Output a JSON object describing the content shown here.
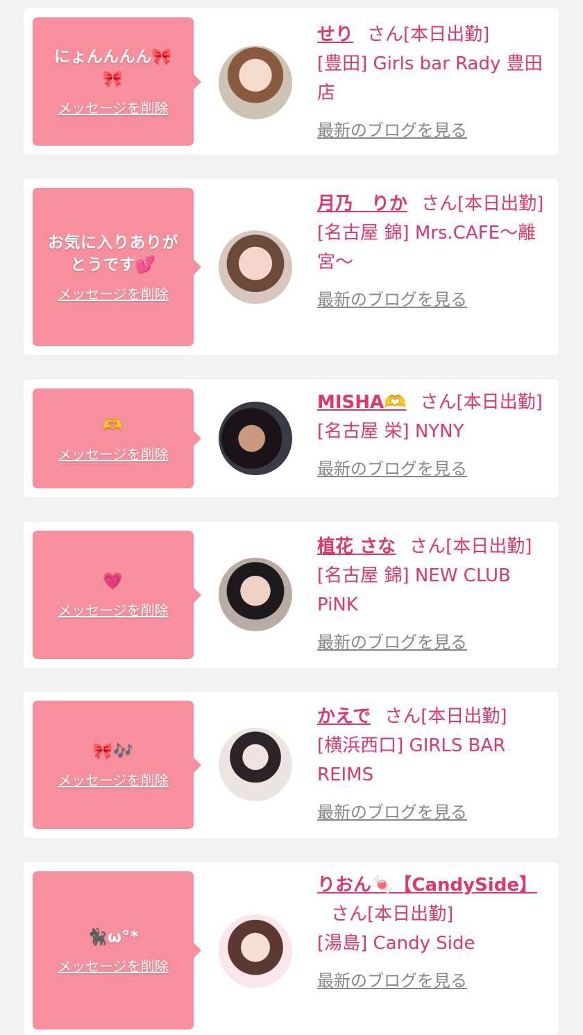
{
  "cards": [
    {
      "message": "にょんんんん🎀🎀",
      "delete_label": "メッセージを削除",
      "name": "せり",
      "san_label": "さん[本日出勤]",
      "shop": "[豊田] Girls bar Rady 豊田店",
      "blog_label": "最新のブログを見る"
    },
    {
      "message": "お気に入りありがとうです💕",
      "delete_label": "メッセージを削除",
      "name": "月乃　りか",
      "san_label": "さん[本日出勤]",
      "shop": "[名古屋 錦] Mrs.CAFE〜離宮〜",
      "blog_label": "最新のブログを見る"
    },
    {
      "message": "🫶",
      "delete_label": "メッセージを削除",
      "name": "MISHA🫶",
      "san_label": "さん[本日出勤]",
      "shop": "[名古屋 栄] NYNY",
      "blog_label": "最新のブログを見る"
    },
    {
      "message": "💗",
      "delete_label": "メッセージを削除",
      "name": "植花 さな",
      "san_label": "さん[本日出勤]",
      "shop": "[名古屋 錦] NEW CLUB PiNK",
      "blog_label": "最新のブログを見る"
    },
    {
      "message": "🎀🎶",
      "delete_label": "メッセージを削除",
      "name": "かえで",
      "san_label": "さん[本日出勤]",
      "shop": "[横浜西口] GIRLS BAR REIMS",
      "blog_label": "最新のブログを見る"
    },
    {
      "message": "🐈‍⬛ω°*",
      "delete_label": "メッセージを削除",
      "name": "りおん🍬【CandySide】",
      "san_label": "さん[本日出勤]",
      "shop": "[湯島] Candy Side",
      "blog_label": "最新のブログを見る"
    }
  ],
  "colors": {
    "accent": "#e0366a",
    "bubble": "#f7909c",
    "muted": "#888888",
    "background": "#f2f2f2"
  }
}
